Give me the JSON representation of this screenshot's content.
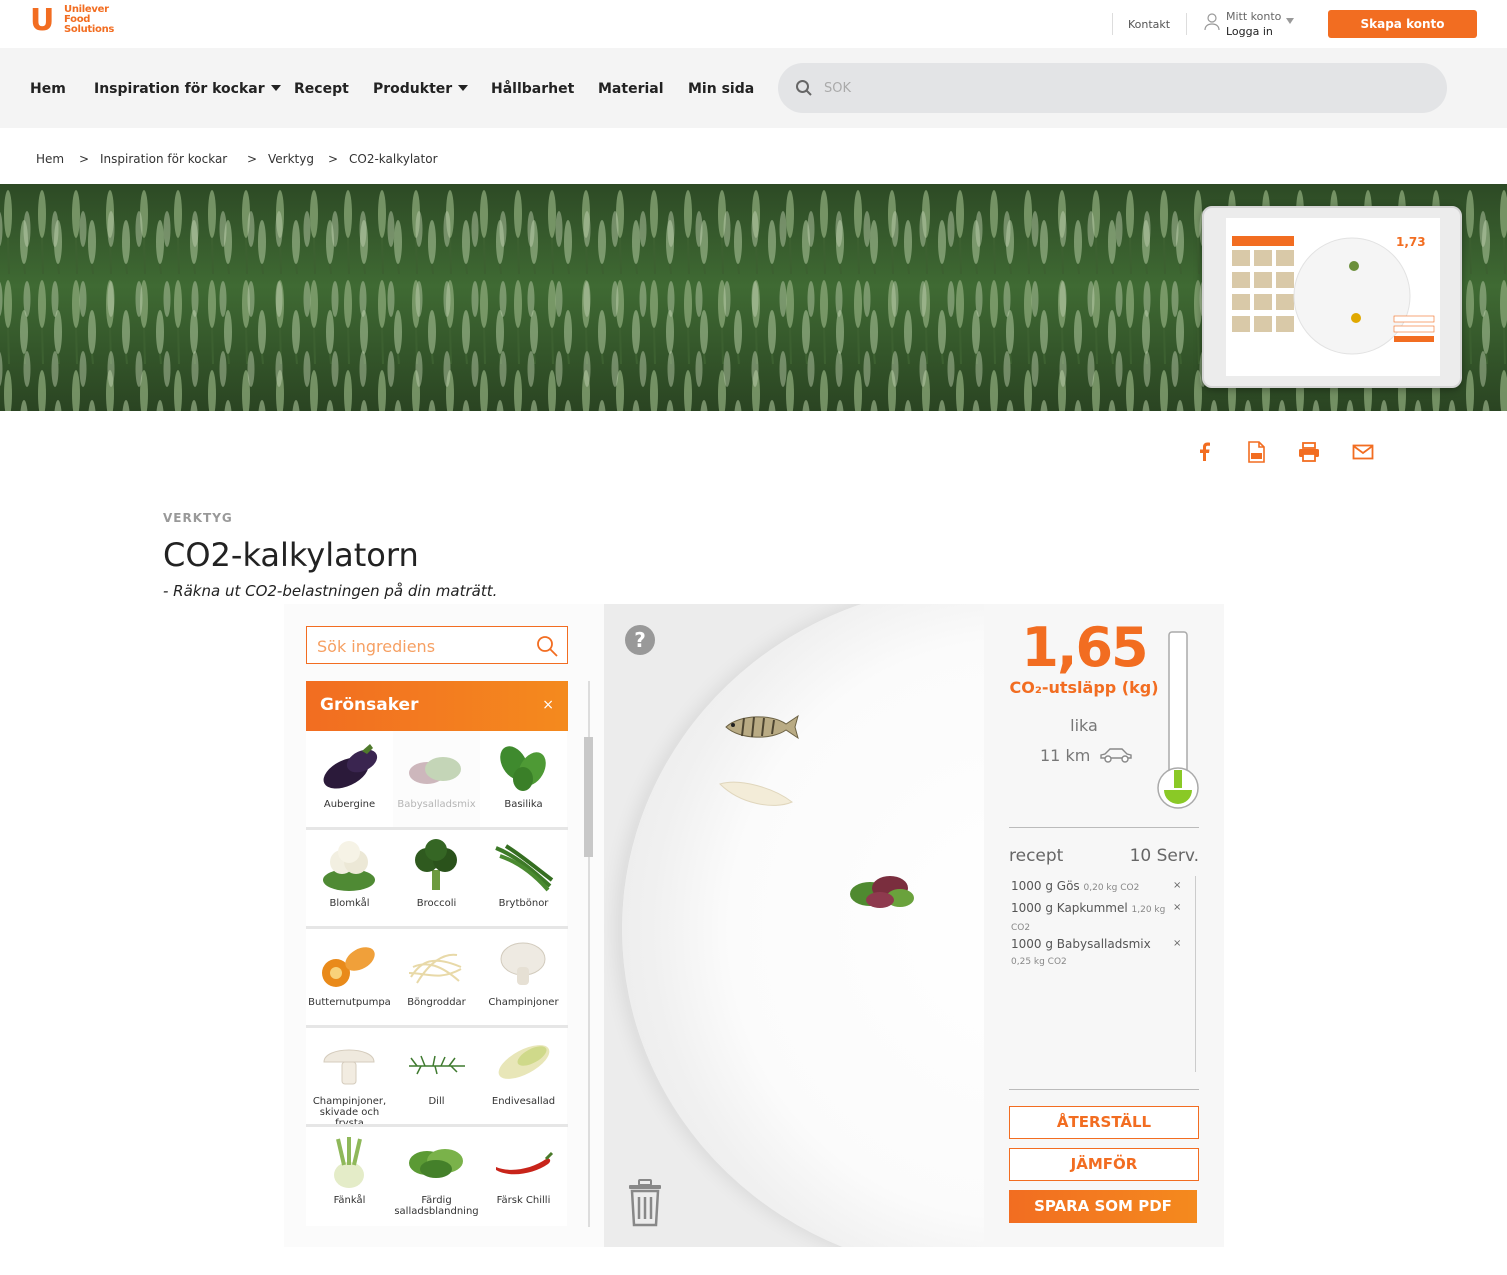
{
  "brand": {
    "logo_letter": "U",
    "logo_text": [
      "Unilever",
      "Food",
      "Solutions"
    ],
    "accent_color": "#f26d21"
  },
  "topbar": {
    "kontakt": "Kontakt",
    "account_line1": "Mitt konto",
    "account_line2": "Logga in",
    "create_account": "Skapa konto"
  },
  "nav": {
    "items": [
      "Hem",
      "Inspiration för kockar",
      "Recept",
      "Produkter",
      "Hållbarhet",
      "Material",
      "Min sida"
    ],
    "search_placeholder": "SÖK"
  },
  "breadcrumb": [
    "Hem",
    ">",
    "Inspiration för kockar",
    ">",
    "Verktyg",
    ">",
    "CO2-kalkylator"
  ],
  "article": {
    "category": "VERKTYG",
    "title": "CO2-kalkylatorn",
    "subtitle": "- Räkna ut CO2-belastningen på din maträtt."
  },
  "share": [
    "facebook-icon",
    "pdf-icon",
    "print-icon",
    "mail-icon"
  ],
  "calculator": {
    "ingredient_search_placeholder": "Sök ingrediens",
    "category": "Grönsaker",
    "category_close": "×",
    "ingredients": [
      "Aubergine",
      "Babysalladsmix",
      "Basilika",
      "Blomkål",
      "Broccoli",
      "Brytbönor",
      "Butternutpumpa",
      "Böngroddar",
      "Champinjoner",
      "Champinjoner, skivade och frysta",
      "Dill",
      "Endivesallad",
      "Fänkål",
      "Färdig salladsblandning",
      "Färsk Chilli"
    ],
    "help": "?",
    "result_value": "1,65",
    "result_unit": "CO₂-utsläpp (kg)",
    "equals_label": "lika",
    "equals_km": "11 km",
    "thermometer_level_fraction": 0.08,
    "recept_label": "recept",
    "servings": "10 Serv.",
    "recipe_items": [
      {
        "name": "1000 g Gös",
        "co2": "0,20 kg CO2",
        "remove": "×"
      },
      {
        "name": "1000 g Kapkummel",
        "co2": "1,20 kg CO2",
        "remove": "×"
      },
      {
        "name": "1000 g Babysalladsmix",
        "co2": "0,25 kg CO2",
        "remove": "×"
      }
    ],
    "buttons": {
      "reset": "ÅTERSTÄLL",
      "compare": "JÄMFÖR",
      "save_pdf": "SPARA SOM PDF"
    }
  }
}
